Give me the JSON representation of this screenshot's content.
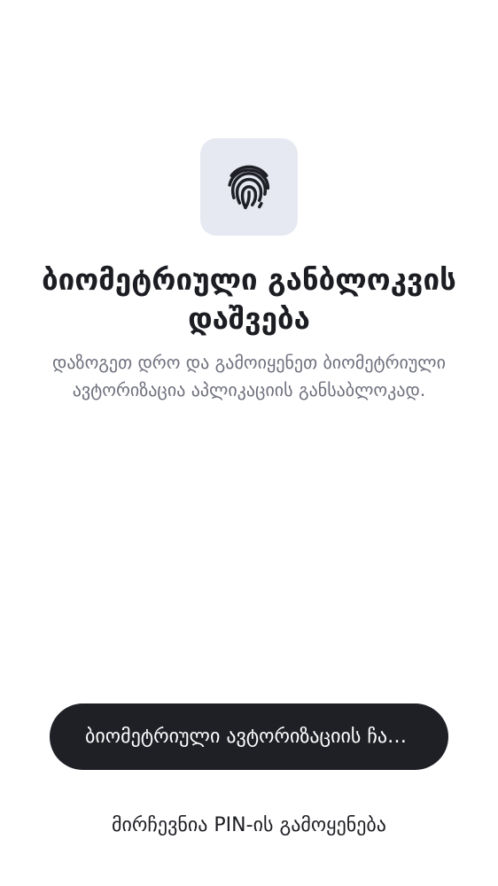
{
  "icon": {
    "name": "fingerprint-icon",
    "background_color": "#e6e9f1",
    "stroke_color": "#1f2026"
  },
  "title": "ბიომეტრიული განბლოკვის დაშვება",
  "subtitle": "დაზოგეთ დრო და გამოიყენეთ ბიომეტრიული ავტორიზაცია აპლიკაციის განსაბლოკად.",
  "primary_button": {
    "label": "ბიომეტრიული ავტორიზაციის ჩართვა",
    "color": "#1f2026"
  },
  "secondary_link": {
    "label": "მირჩევნია PIN-ის გამოყენება"
  }
}
